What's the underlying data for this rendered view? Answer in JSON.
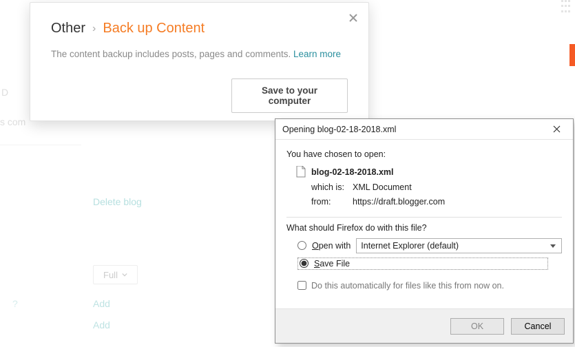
{
  "bg": {
    "letter_d": "D",
    "s_com": "s com",
    "delete_blog": "Delete blog",
    "full_label": "Full",
    "question": "?",
    "add1": "Add",
    "add2": "Add"
  },
  "modal": {
    "breadcrumb_root": "Other",
    "breadcrumb_chevron": "›",
    "breadcrumb_leaf": "Back up Content",
    "description": "The content backup includes posts, pages and comments. ",
    "learn_more": "Learn more",
    "save_button": "Save to your computer"
  },
  "ffdialog": {
    "title": "Opening blog-02-18-2018.xml",
    "chosen_text": "You have chosen to open:",
    "filename": "blog-02-18-2018.xml",
    "which_is_label": "which is:",
    "which_is_value": "XML Document",
    "from_label": "from:",
    "from_value": "https://draft.blogger.com",
    "question": "What should Firefox do with this file?",
    "open_with_prefix": "O",
    "open_with_rest": "pen with",
    "open_with_app": "Internet Explorer (default)",
    "save_file_prefix": "S",
    "save_file_rest": "ave File",
    "auto_text": "Do this automatically for files like this from now on.",
    "ok": "OK",
    "cancel": "Cancel"
  }
}
